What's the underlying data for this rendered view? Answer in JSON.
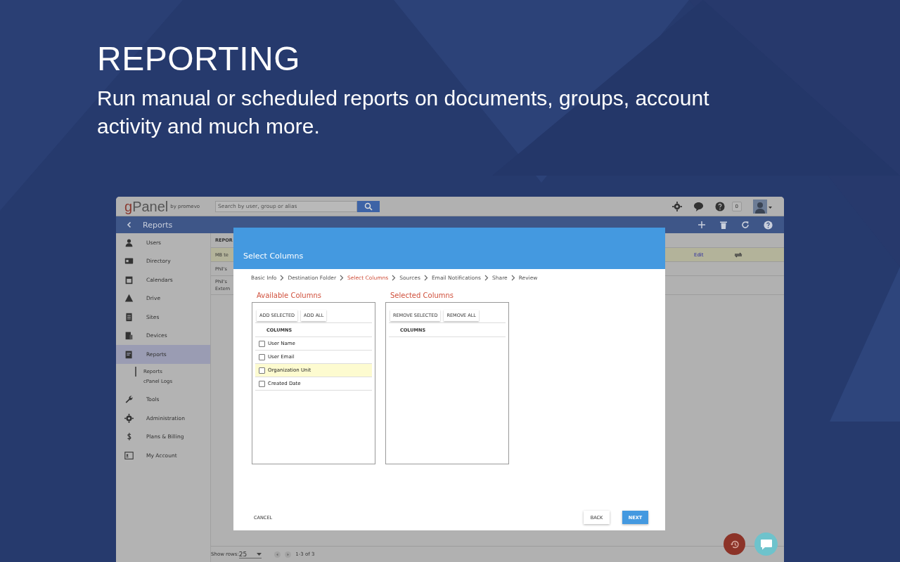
{
  "hero": {
    "title": "REPORTING",
    "subtitle": "Run manual or scheduled reports on documents, groups, account activity and much more."
  },
  "app": {
    "logo_first": "g",
    "logo_rest": "Panel",
    "logo_byline": "by promevo",
    "search": {
      "placeholder": "Search by user, group or alias"
    },
    "notification_count": "0",
    "page_title": "Reports",
    "sidebar": {
      "items": [
        {
          "label": "Users",
          "selected": false
        },
        {
          "label": "Directory",
          "selected": false
        },
        {
          "label": "Calendars",
          "selected": false
        },
        {
          "label": "Drive",
          "selected": false
        },
        {
          "label": "Sites",
          "selected": false
        },
        {
          "label": "Devices",
          "selected": false
        },
        {
          "label": "Reports",
          "selected": true,
          "children": [
            {
              "label": "Reports",
              "selected": true
            },
            {
              "label": "cPanel Logs",
              "selected": false
            }
          ]
        },
        {
          "label": "Tools",
          "selected": false
        },
        {
          "label": "Administration",
          "selected": false
        },
        {
          "label": "Plans & Billing",
          "selected": false
        },
        {
          "label": "My Account",
          "selected": false
        }
      ]
    },
    "table": {
      "header": "REPOR",
      "rows": [
        {
          "lines": [
            "MB te"
          ],
          "highlighted": true,
          "action": "Edit"
        },
        {
          "lines": [
            "Phil's"
          ],
          "highlighted": false
        },
        {
          "lines": [
            "Phil's",
            "Extern"
          ],
          "highlighted": false
        }
      ]
    },
    "pagination": {
      "label": "Show rows:",
      "rows_value": "25",
      "range": "1-3 of 3"
    }
  },
  "modal": {
    "title": "Select Columns",
    "steps": [
      {
        "label": "Basic Info",
        "selected": false
      },
      {
        "label": "Destination Folder",
        "selected": false
      },
      {
        "label": "Select Columns",
        "selected": true
      },
      {
        "label": "Sources",
        "selected": false
      },
      {
        "label": "Email Notifications",
        "selected": false
      },
      {
        "label": "Share",
        "selected": false
      },
      {
        "label": "Review",
        "selected": false
      }
    ],
    "panels": [
      {
        "title": "Available Columns",
        "buttons": [
          "ADD SELECTED",
          "ADD ALL"
        ],
        "column_header": "COLUMNS",
        "items": [
          {
            "label": "User Name",
            "checked": false,
            "highlighted": false
          },
          {
            "label": "User Email",
            "checked": false,
            "highlighted": false
          },
          {
            "label": "Organization Unit",
            "checked": false,
            "highlighted": true
          },
          {
            "label": "Created Date",
            "checked": false,
            "highlighted": false
          }
        ]
      },
      {
        "title": "Selected Columns",
        "buttons": [
          "REMOVE SELECTED",
          "REMOVE ALL"
        ],
        "column_header": "COLUMNS"
      }
    ],
    "cancel": "CANCEL",
    "back": "BACK",
    "next": "NEXT"
  }
}
